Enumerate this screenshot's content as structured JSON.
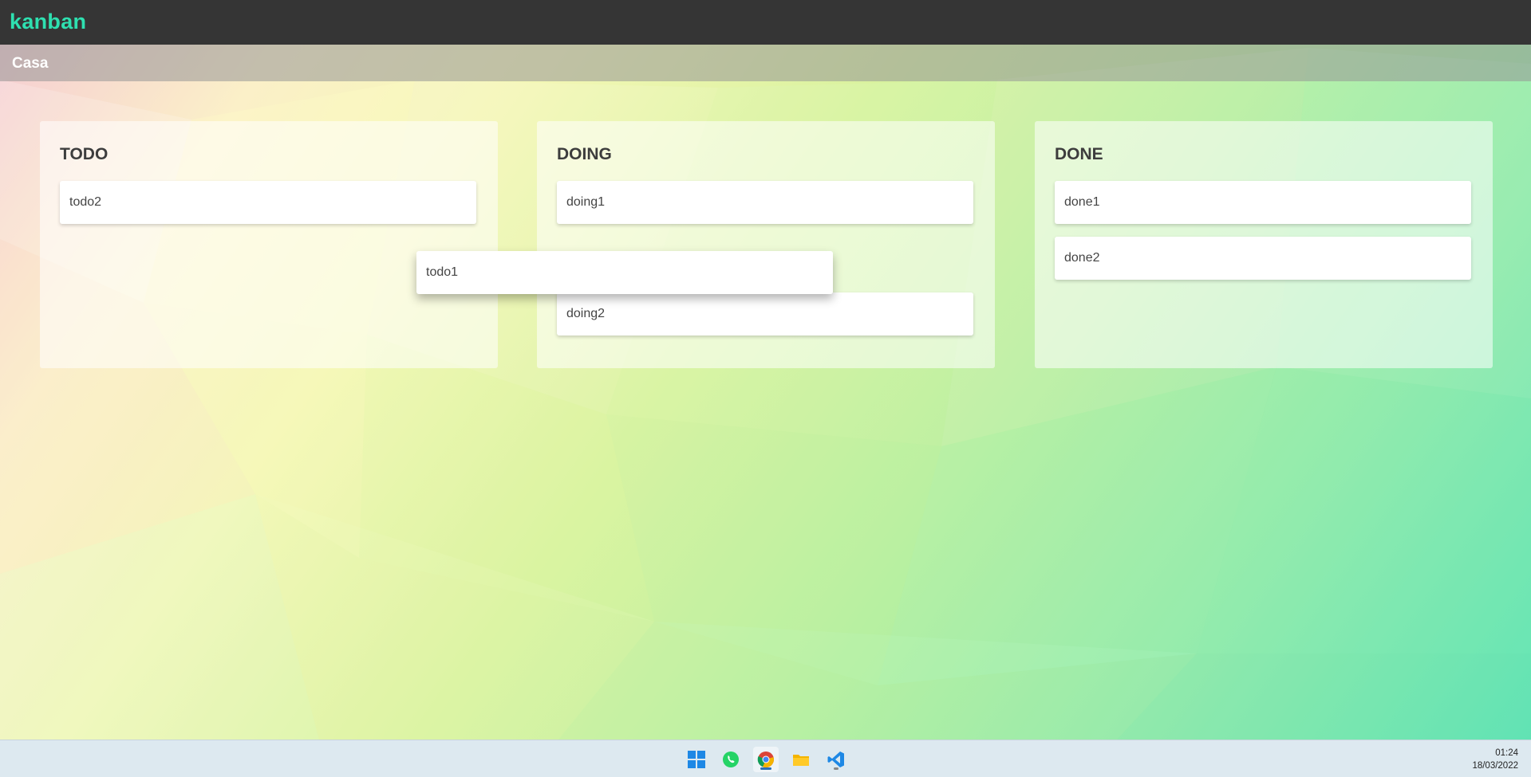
{
  "app": {
    "title": "kanban"
  },
  "board": {
    "name": "Casa"
  },
  "columns": [
    {
      "title": "TODO",
      "cards": [
        "todo2"
      ]
    },
    {
      "title": "DOING",
      "cards": [
        "doing1",
        "doing2"
      ]
    },
    {
      "title": "DONE",
      "cards": [
        "done1",
        "done2"
      ]
    }
  ],
  "dragging_card": {
    "label": "todo1"
  },
  "taskbar": {
    "icons": [
      "windows-start-icon",
      "whatsapp-icon",
      "chrome-icon",
      "file-explorer-icon",
      "vscode-icon"
    ],
    "time": "01:24",
    "date": "18/03/2022"
  },
  "colors": {
    "brand": "#2ee0b0",
    "topbar": "#353535"
  }
}
